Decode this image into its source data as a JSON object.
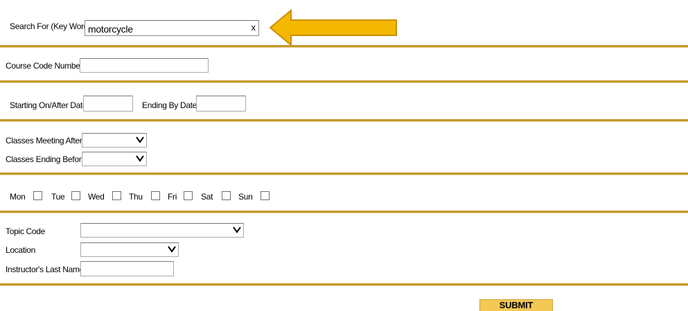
{
  "search": {
    "label": "Search For (Key Word)",
    "value": "motorcycle",
    "clear_label": "x",
    "pointer_icon": "arrow-left-icon",
    "pointer_color": "#f5b800"
  },
  "course_code": {
    "label": "Course Code Number",
    "value": ""
  },
  "dates": {
    "start_label": "Starting On/After Date",
    "start_value": "",
    "end_label": "Ending By Date",
    "end_value": ""
  },
  "times": {
    "after_label": "Classes Meeting After",
    "after_value": "",
    "before_label": "Classes Ending Before",
    "before_value": ""
  },
  "days": [
    {
      "label": "Mon",
      "checked": false
    },
    {
      "label": "Tue",
      "checked": false
    },
    {
      "label": "Wed",
      "checked": false
    },
    {
      "label": "Thu",
      "checked": false
    },
    {
      "label": "Fri",
      "checked": false
    },
    {
      "label": "Sat",
      "checked": false
    },
    {
      "label": "Sun",
      "checked": false
    }
  ],
  "filters": {
    "topic_label": "Topic Code",
    "topic_value": "",
    "location_label": "Location",
    "location_value": "",
    "instructor_label": "Instructor's Last Name",
    "instructor_value": ""
  },
  "submit_label": "SUBMIT",
  "colors": {
    "divider": "#c39a2e",
    "submit_bg": "#f3c854"
  }
}
